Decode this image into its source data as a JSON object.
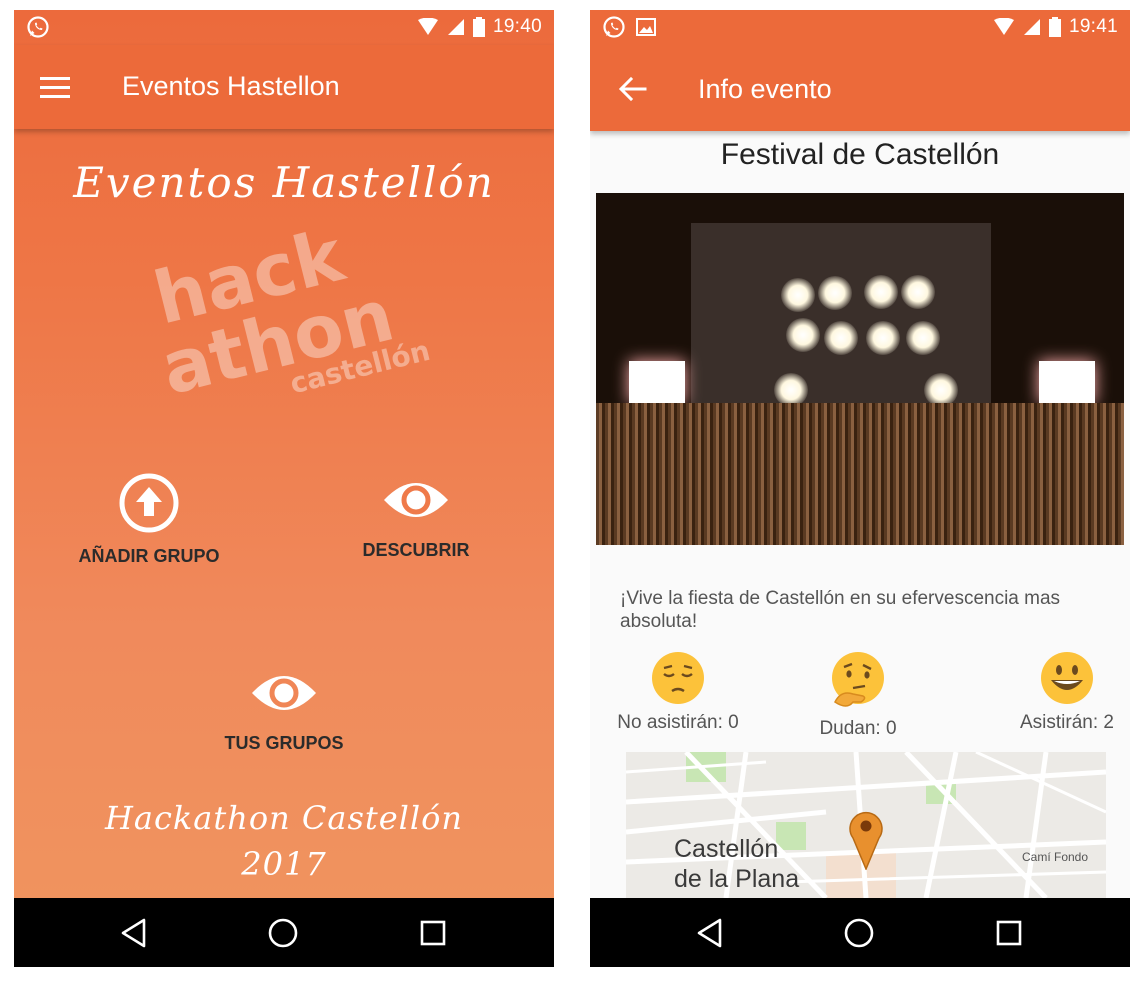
{
  "left_screen": {
    "status_bar": {
      "time": "19:40"
    },
    "app_bar": {
      "title": "Eventos Hastellon"
    },
    "hero_title": "Eventos Hastellón",
    "logo": {
      "line1": "hack",
      "line2": "athon",
      "line3": "castellón"
    },
    "actions": {
      "add_group": "AÑADIR GRUPO",
      "discover": "DESCUBRIR",
      "your_groups": "TUS GRUPOS"
    },
    "footer_line1": "Hackathon Castellón",
    "footer_line2": "2017"
  },
  "right_screen": {
    "status_bar": {
      "time": "19:41"
    },
    "app_bar": {
      "title": "Info evento"
    },
    "event": {
      "title": "Festival de Castellón",
      "description": "¡Vive la fiesta de Castellón en su efervescencia mas absoluta!"
    },
    "reactions": {
      "no": "No asistirán: 0",
      "maybe": "Dudan: 0",
      "yes": "Asistirán: 2"
    },
    "map": {
      "city_line1": "Castellón",
      "city_line2": "de la Plana",
      "street": "Camí Fondo"
    }
  },
  "colors": {
    "primary": "#ec6a3a",
    "navbar": "#000000",
    "marker": "#e8902e"
  }
}
